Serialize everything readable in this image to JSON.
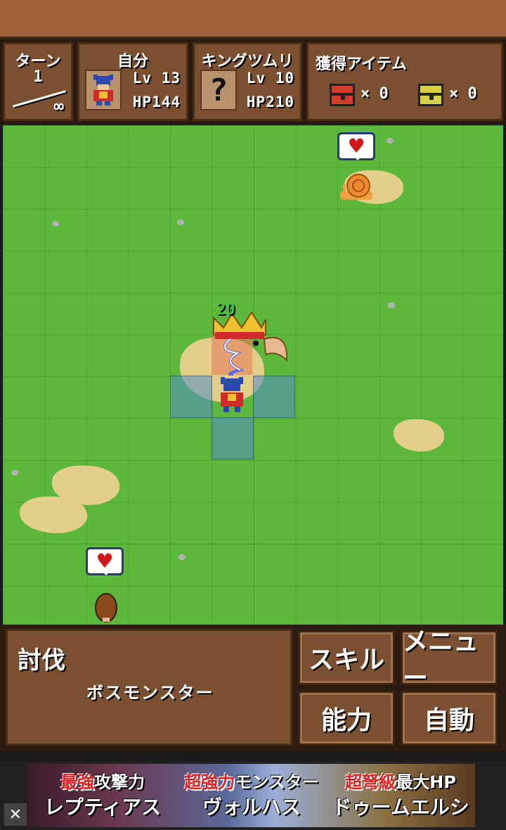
{
  "hud": {
    "turn": {
      "title": "ターン",
      "current": "1",
      "max": "∞"
    },
    "self": {
      "title": "自分",
      "lv": "Lv 13",
      "hp": "HP144"
    },
    "enemy": {
      "title": "キングツムリ",
      "portrait": "?",
      "lv": "Lv 10",
      "hp": "HP210"
    },
    "items": {
      "title": "獲得アイテム",
      "red_chest_count": "× 0",
      "yellow_chest_count": "× 0"
    }
  },
  "board": {
    "damage_number": "20",
    "bubble_heart": "♥"
  },
  "message": {
    "title": "討伐",
    "body": "ボスモンスター"
  },
  "commands": {
    "skill": "スキル",
    "menu": "メニュー",
    "ability": "能力",
    "auto": "自動"
  },
  "ad": {
    "cells": [
      {
        "highlight": "最強",
        "rest": "攻撃力",
        "name": "レプティアス"
      },
      {
        "highlight": "超強力",
        "rest": "モンスター",
        "name": "ヴォルハス"
      },
      {
        "highlight": "超弩級",
        "rest": "最大HP",
        "name": "ドゥームエルシュ"
      }
    ],
    "close": "✕"
  },
  "colors": {
    "grass": "#5cb83a",
    "panel": "#7a5030",
    "heart": "#d01818"
  }
}
